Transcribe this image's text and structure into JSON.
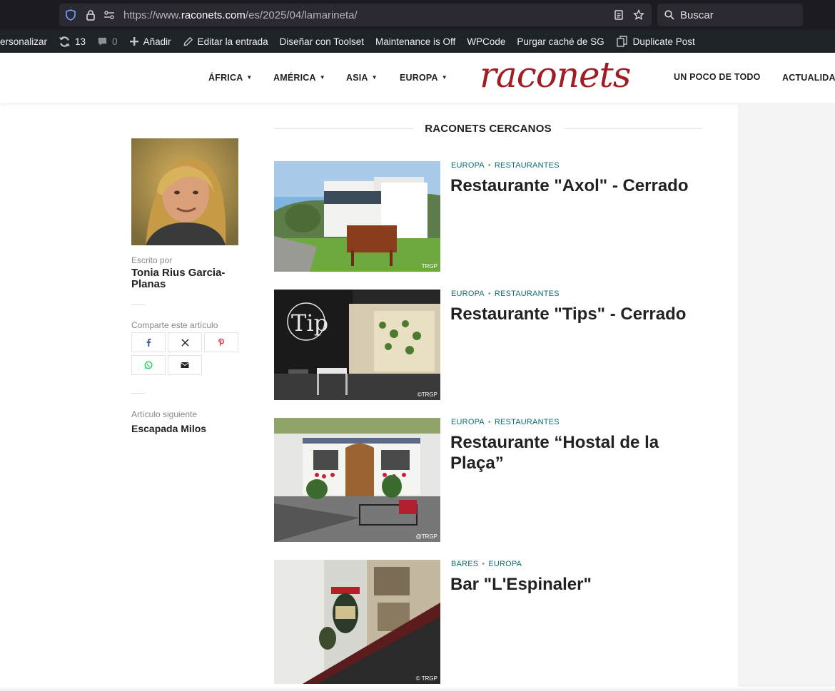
{
  "browser": {
    "url_prefix": "https://www.",
    "url_domain": "raconets.com",
    "url_path": "/es/2025/04/lamarineta/",
    "search_placeholder": "Buscar"
  },
  "adminbar": {
    "customize": "ersonalizar",
    "updates_count": "13",
    "comments_count": "0",
    "add_new": "Añadir",
    "edit_post": "Editar la entrada",
    "design_toolset": "Diseñar con Toolset",
    "maintenance": "Maintenance is Off",
    "wpcode": "WPCode",
    "purge_cache": "Purgar caché de SG",
    "duplicate_post": "Duplicate Post"
  },
  "header": {
    "logo": "raconets",
    "nav": [
      "ÁFRICA",
      "AMÉRICA",
      "ASIA",
      "EUROPA",
      "UN POCO DE TODO",
      "ACTUALIDAD"
    ]
  },
  "sidebar": {
    "written_by_label": "Escrito por",
    "author_name": "Tonia Rius Garcia-Planas",
    "share_label": "Comparte este artículo",
    "next_label": "Artículo siguiente",
    "next_title": "Escapada Milos"
  },
  "related": {
    "heading": "RACONETS CERCANOS",
    "posts": [
      {
        "cat1": "EUROPA",
        "cat2": "RESTAURANTES",
        "title": "Restaurante \"Axol\" - Cerrado",
        "watermark": "TRGP"
      },
      {
        "cat1": "EUROPA",
        "cat2": "RESTAURANTES",
        "title": "Restaurante \"Tips\" - Cerrado",
        "watermark": "©TRGP"
      },
      {
        "cat1": "EUROPA",
        "cat2": "RESTAURANTES",
        "title": "Restaurante “Hostal de la Plaça”",
        "watermark": "@TRGP"
      },
      {
        "cat1": "BARES",
        "cat2": "EUROPA",
        "title": "Bar \"L'Espinaler\"",
        "watermark": "© TRGP"
      }
    ]
  },
  "colors": {
    "brand": "#a01d24",
    "category": "#0e6f73"
  }
}
